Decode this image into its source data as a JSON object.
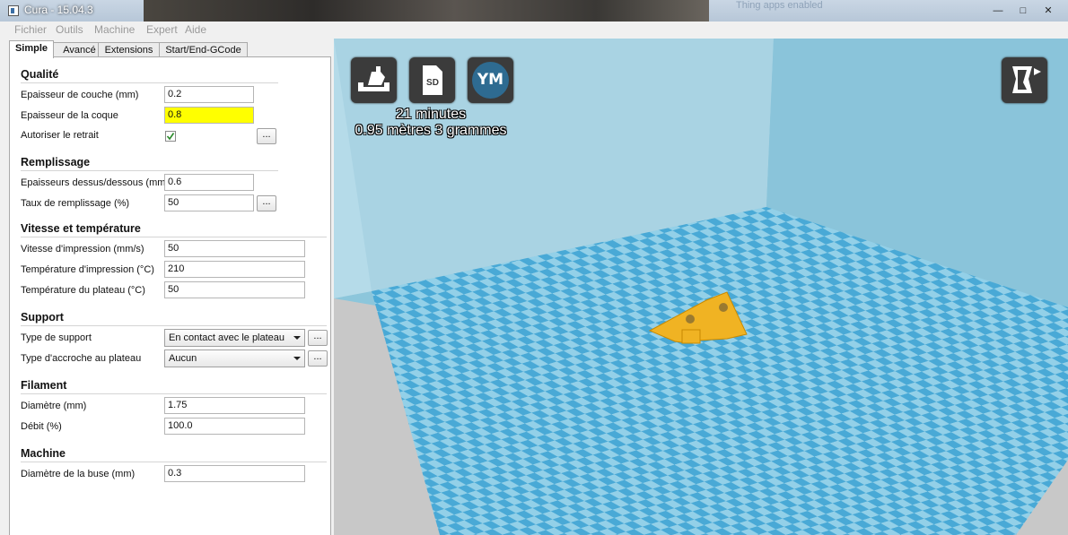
{
  "window": {
    "title": "Cura - 15.04.3",
    "background_text": "Thing apps enabled"
  },
  "menu": [
    "Fichier",
    "Outils",
    "Machine",
    "Expert",
    "Aide"
  ],
  "tabs": [
    "Simple",
    "Avancé",
    "Extensions",
    "Start/End-GCode"
  ],
  "sections": {
    "qualite": {
      "title": "Qualité",
      "layer_height": {
        "label": "Epaisseur de couche (mm)",
        "value": "0.2"
      },
      "shell_thickness": {
        "label": "Epaisseur de la coque",
        "value": "0.8"
      },
      "retraction": {
        "label": "Autoriser le retrait",
        "checked": true,
        "more": "..."
      }
    },
    "remplissage": {
      "title": "Remplissage",
      "top_bottom": {
        "label": "Epaisseurs dessus/dessous (mm)",
        "value": "0.6"
      },
      "density": {
        "label": "Taux de remplissage (%)",
        "value": "50",
        "more": "..."
      }
    },
    "vitesse": {
      "title": "Vitesse et température",
      "print_speed": {
        "label": "Vitesse d'impression (mm/s)",
        "value": "50"
      },
      "print_temp": {
        "label": "Température d'impression (°C)",
        "value": "210"
      },
      "bed_temp": {
        "label": "Température du plateau (°C)",
        "value": "50"
      }
    },
    "support": {
      "title": "Support",
      "support_type": {
        "label": "Type de support",
        "value": "En contact avec le plateau",
        "more": "..."
      },
      "adhesion": {
        "label": "Type d'accroche au plateau",
        "value": "Aucun",
        "more": "..."
      }
    },
    "filament": {
      "title": "Filament",
      "diameter": {
        "label": "Diamètre (mm)",
        "value": "1.75"
      },
      "flow": {
        "label": "Débit (%)",
        "value": "100.0"
      }
    },
    "machine": {
      "title": "Machine",
      "nozzle": {
        "label": "Diamètre de la buse (mm)",
        "value": "0.3"
      }
    }
  },
  "viewport": {
    "icons": {
      "load": "load-model-icon",
      "sd": "SD",
      "ym": "YM",
      "view": "view-mode-icon"
    },
    "print_time": "21 minutes",
    "print_material": "0.95 mètres 3 grammes",
    "colors": {
      "wall_left": "#a9d3e3",
      "wall_back": "#8cc6db",
      "floor_light": "#93d0e8",
      "floor_dark": "#49a9d6",
      "model": "#f0b323"
    }
  }
}
